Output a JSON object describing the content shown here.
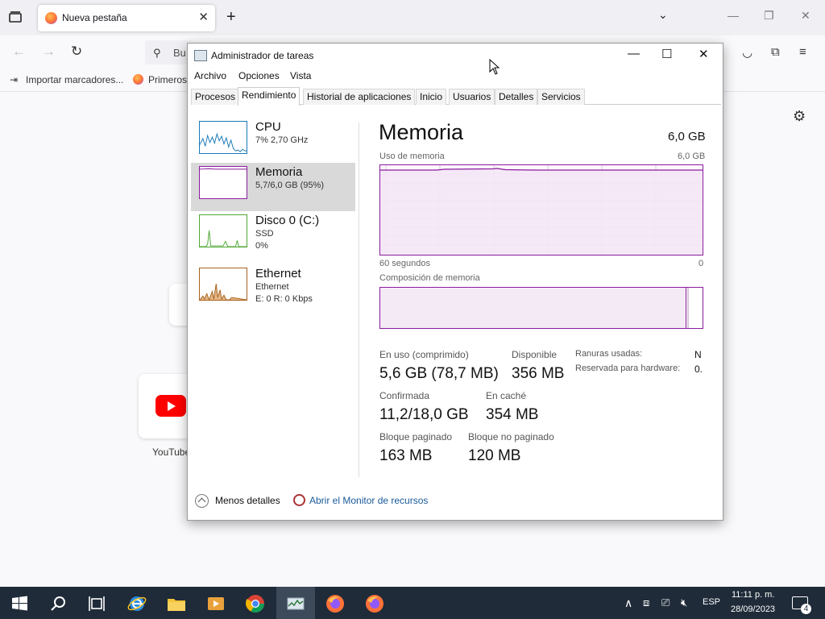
{
  "browser": {
    "tab_title": "Nueva pestaña",
    "url_placeholder": "Bu",
    "bookmarks": [
      "Importar marcadores...",
      "Primeros"
    ],
    "tile_label": "YouTube"
  },
  "task_manager": {
    "title": "Administrador de tareas",
    "menu": [
      "Archivo",
      "Opciones",
      "Vista"
    ],
    "tabs": [
      "Procesos",
      "Rendimiento",
      "Historial de aplicaciones",
      "Inicio",
      "Usuarios",
      "Detalles",
      "Servicios"
    ],
    "active_tab": "Rendimiento",
    "perf_items": [
      {
        "name": "CPU",
        "sub1": "7% 2,70 GHz",
        "sub2": ""
      },
      {
        "name": "Memoria",
        "sub1": "5,7/6,0 GB (95%)",
        "sub2": ""
      },
      {
        "name": "Disco 0 (C:)",
        "sub1": "SSD",
        "sub2": "0%"
      },
      {
        "name": "Ethernet",
        "sub1": "Ethernet",
        "sub2": "E: 0 R: 0 Kbps"
      }
    ],
    "heading": "Memoria",
    "total": "6,0 GB",
    "usage_label": "Uso de memoria",
    "usage_max": "6,0 GB",
    "axis_left": "60 segundos",
    "axis_right": "0",
    "composition_label": "Composición de memoria",
    "stats": {
      "in_use_label": "En uso (comprimido)",
      "in_use_value": "5,6 GB (78,7 MB)",
      "available_label": "Disponible",
      "available_value": "356 MB",
      "committed_label": "Confirmada",
      "committed_value": "11,2/18,0 GB",
      "cached_label": "En caché",
      "cached_value": "354 MB",
      "paged_label": "Bloque paginado",
      "paged_value": "163 MB",
      "nonpaged_label": "Bloque no paginado",
      "nonpaged_value": "120 MB",
      "slots_label": "Ranuras usadas:",
      "slots_value": "N",
      "reserved_label": "Reservada para hardware:",
      "reserved_value": "0."
    },
    "footer": {
      "less_details": "Menos detalles",
      "resource_monitor": "Abrir el Monitor de recursos"
    }
  },
  "taskbar": {
    "language": "ESP",
    "time": "11:11 p. m.",
    "date": "28/09/2023",
    "notifications": "4"
  }
}
